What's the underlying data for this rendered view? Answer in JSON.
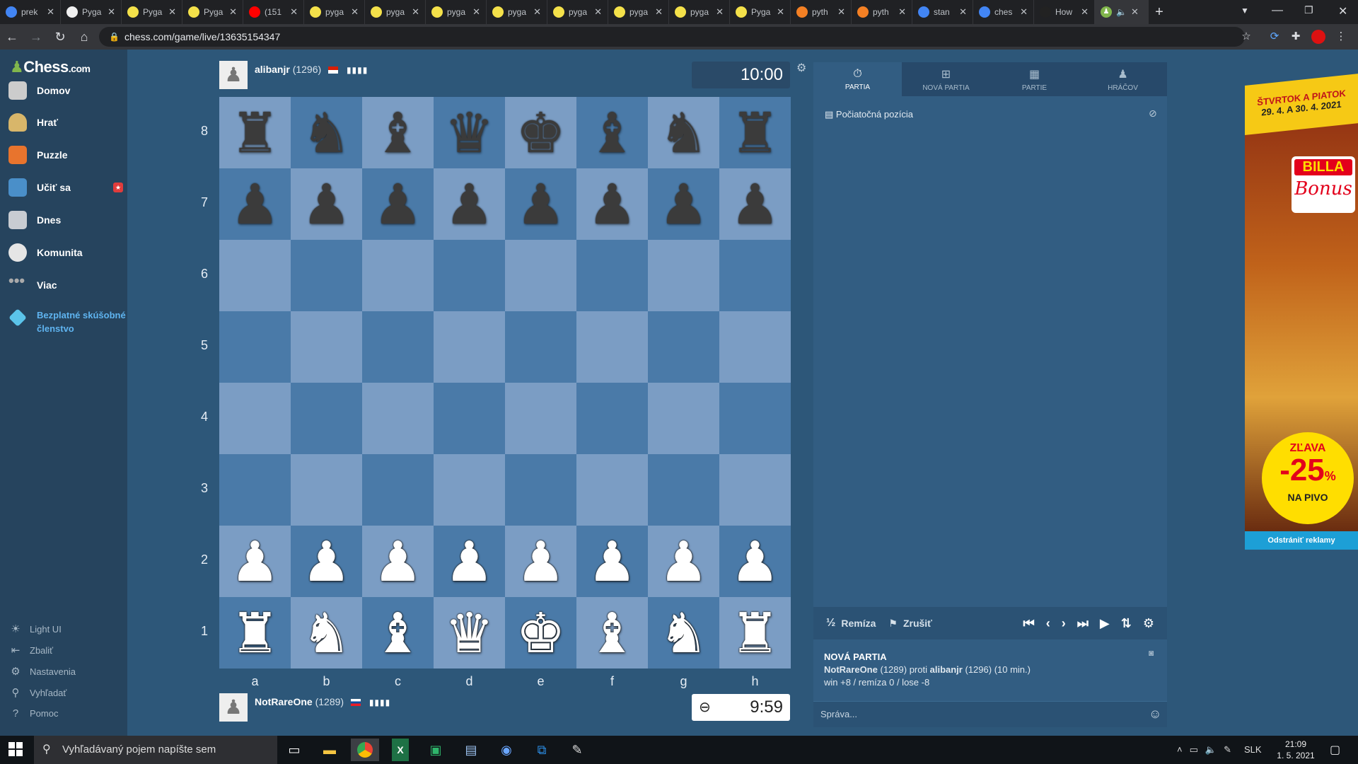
{
  "browser": {
    "tabs": [
      {
        "title": "prek",
        "icon": "google-icon"
      },
      {
        "title": "Pyga",
        "icon": "github-icon"
      },
      {
        "title": "Pyga",
        "icon": "pygame-icon"
      },
      {
        "title": "Pyga",
        "icon": "pygame-icon"
      },
      {
        "title": "(151",
        "icon": "youtube-icon"
      },
      {
        "title": "pyga",
        "icon": "pygame-icon"
      },
      {
        "title": "pyga",
        "icon": "pygame-icon"
      },
      {
        "title": "pyga",
        "icon": "pygame-icon"
      },
      {
        "title": "pyga",
        "icon": "pygame-icon"
      },
      {
        "title": "pyga",
        "icon": "pygame-icon"
      },
      {
        "title": "pyga",
        "icon": "pygame-icon"
      },
      {
        "title": "pyga",
        "icon": "pygame-icon"
      },
      {
        "title": "Pyga",
        "icon": "pygame-icon"
      },
      {
        "title": "pyth",
        "icon": "stackoverflow-icon"
      },
      {
        "title": "pyth",
        "icon": "stackoverflow-icon"
      },
      {
        "title": "stan",
        "icon": "google-icon"
      },
      {
        "title": "ches",
        "icon": "google-icon"
      },
      {
        "title": "How",
        "icon": "google-g-icon"
      }
    ],
    "url": "chess.com/game/live/13635154347"
  },
  "sidebar": {
    "logo": "Chess",
    "logo_suffix": ".com",
    "items": [
      "Domov",
      "Hrať",
      "Puzzle",
      "Učiť sa",
      "Dnes",
      "Komunita",
      "Viac"
    ],
    "trial": "Bezplatné skúšobné členstvo",
    "bottom": [
      "Light UI",
      "Zbaliť",
      "Nastavenia",
      "Vyhľadať",
      "Pomoc"
    ]
  },
  "top_player": {
    "name": "alibanjr",
    "rating": "(1296)",
    "clock": "10:00"
  },
  "bottom_player": {
    "name": "NotRareOne",
    "rating": "(1289)",
    "clock": "9:59"
  },
  "board": {
    "ranks": [
      "8",
      "7",
      "6",
      "5",
      "4",
      "3",
      "2",
      "1"
    ],
    "files": [
      "a",
      "b",
      "c",
      "d",
      "e",
      "f",
      "g",
      "h"
    ],
    "pieces": [
      [
        "♜",
        "♞",
        "♝",
        "♛",
        "♚",
        "♝",
        "♞",
        "♜"
      ],
      [
        "♟",
        "♟",
        "♟",
        "♟",
        "♟",
        "♟",
        "♟",
        "♟"
      ],
      [
        "",
        "",
        "",
        "",
        "",
        "",
        "",
        ""
      ],
      [
        "",
        "",
        "",
        "",
        "",
        "",
        "",
        ""
      ],
      [
        "",
        "",
        "",
        "",
        "",
        "",
        "",
        ""
      ],
      [
        "",
        "",
        "",
        "",
        "",
        "",
        "",
        ""
      ],
      [
        "♟",
        "♟",
        "♟",
        "♟",
        "♟",
        "♟",
        "♟",
        "♟"
      ],
      [
        "♜",
        "♞",
        "♝",
        "♛",
        "♚",
        "♝",
        "♞",
        "♜"
      ]
    ]
  },
  "panel": {
    "tabs": [
      "PARTIA",
      "NOVÁ PARTIA",
      "PARTIE",
      "HRÁČOV"
    ],
    "opening": "Počiatočná pozícia",
    "draw": "Remíza",
    "abort": "Zrušiť",
    "game_title": "NOVÁ PARTIA",
    "white": "NotRareOne",
    "white_rating": "(1289)",
    "vs": "proti",
    "black": "alibanjr",
    "black_rating": "(1296)",
    "time_control": "(10 min.)",
    "score_line": "win +8 / remíza 0 / lose -8",
    "chat_placeholder": "Správa..."
  },
  "ad": {
    "top": "ŠTVRTOK A PIATOK",
    "date": "29. 4. A 30. 4. 2021",
    "brand": "BILLA",
    "bonus": "Bonus",
    "discount_label": "ZĽAVA",
    "discount": "-25",
    "unit": "%",
    "product": "NA PIVO",
    "remove": "Odstrániť reklamy"
  },
  "taskbar": {
    "search": "Vyhľadávaný pojem napíšte sem",
    "lang": "SLK",
    "time": "21:09",
    "date": "1. 5. 2021"
  }
}
